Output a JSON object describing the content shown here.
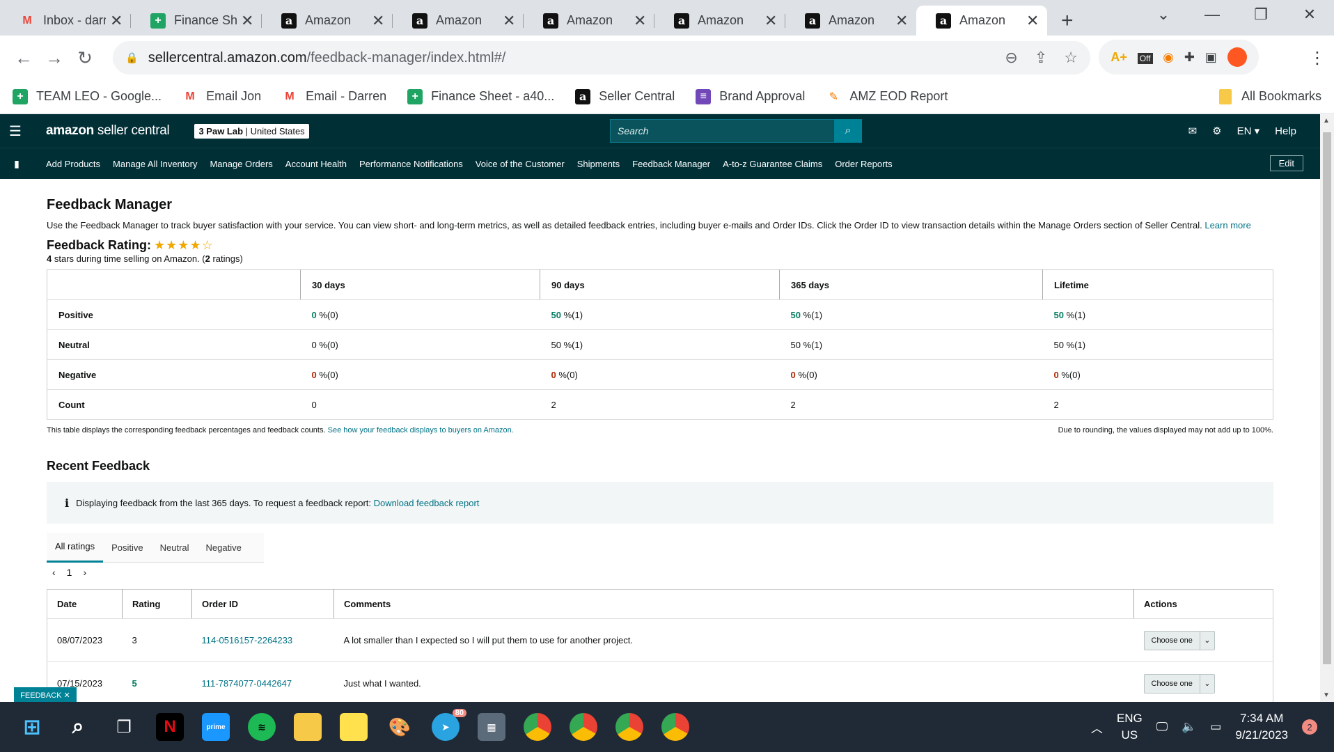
{
  "browser": {
    "tabs": [
      {
        "title": "Inbox - darr",
        "icon": "gmail"
      },
      {
        "title": "Finance She",
        "icon": "sheets"
      },
      {
        "title": "Amazon",
        "icon": "amazon"
      },
      {
        "title": "Amazon",
        "icon": "amazon"
      },
      {
        "title": "Amazon",
        "icon": "amazon"
      },
      {
        "title": "Amazon",
        "icon": "amazon"
      },
      {
        "title": "Amazon",
        "icon": "amazon"
      },
      {
        "title": "Amazon",
        "icon": "amazon"
      }
    ],
    "url_host": "sellercentral.amazon.com",
    "url_path": "/feedback-manager/index.html#/",
    "ext_off": "Off",
    "bookmarks": [
      {
        "label": "TEAM LEO - Google...",
        "icon": "sheets"
      },
      {
        "label": "Email Jon",
        "icon": "gmail"
      },
      {
        "label": "Email - Darren",
        "icon": "gmail"
      },
      {
        "label": "Finance Sheet - a40...",
        "icon": "sheets"
      },
      {
        "label": "Seller Central",
        "icon": "amazon"
      },
      {
        "label": "Brand Approval",
        "icon": "forms"
      },
      {
        "label": "AMZ EOD Report",
        "icon": "report"
      }
    ],
    "all_bookmarks": "All Bookmarks"
  },
  "header": {
    "brand_bold": "amazon",
    "brand_light": " seller central",
    "store_bold": "3 Paw Lab",
    "store_region": "United States",
    "search_placeholder": "Search",
    "lang": "EN",
    "help": "Help",
    "nav": [
      "Add Products",
      "Manage All Inventory",
      "Manage Orders",
      "Account Health",
      "Performance Notifications",
      "Voice of the Customer",
      "Shipments",
      "Feedback Manager",
      "A-to-z Guarantee Claims",
      "Order Reports"
    ],
    "edit": "Edit"
  },
  "page": {
    "title": "Feedback Manager",
    "description": "Use the Feedback Manager to track buyer satisfaction with your service. You can view short- and long-term metrics, as well as detailed feedback entries, including buyer e-mails and Order IDs. Click the Order ID to view transaction details within the Manage Orders section of Seller Central.",
    "learn_more": "Learn more",
    "rating_title": "Feedback Rating:",
    "rating_stars": 4,
    "rating_sub_stars": "4",
    "rating_sub_text1": " stars during time selling on Amazon. (",
    "rating_sub_count": "2",
    "rating_sub_text2": " ratings)",
    "metrics": {
      "columns": [
        "30 days",
        "90 days",
        "365 days",
        "Lifetime"
      ],
      "rows": [
        {
          "label": "Positive",
          "tone": "g",
          "cells": [
            [
              "0",
              " %(0)"
            ],
            [
              "50",
              " %(1)"
            ],
            [
              "50",
              " %(1)"
            ],
            [
              "50",
              " %(1)"
            ]
          ]
        },
        {
          "label": "Neutral",
          "tone": "",
          "cells": [
            [
              "0",
              " %(0)"
            ],
            [
              "50",
              " %(1)"
            ],
            [
              "50",
              " %(1)"
            ],
            [
              "50",
              " %(1)"
            ]
          ]
        },
        {
          "label": "Negative",
          "tone": "r",
          "cells": [
            [
              "0",
              " %(0)"
            ],
            [
              "0",
              " %(0)"
            ],
            [
              "0",
              " %(0)"
            ],
            [
              "0",
              " %(0)"
            ]
          ]
        },
        {
          "label": "Count",
          "tone": "",
          "cells": [
            [
              "0",
              ""
            ],
            [
              "2",
              ""
            ],
            [
              "2",
              ""
            ],
            [
              "2",
              ""
            ]
          ]
        }
      ]
    },
    "note_left": "This table displays the corresponding feedback percentages and feedback counts.",
    "note_link": "See how your feedback displays to buyers on Amazon.",
    "note_right": "Due to rounding, the values displayed may not add up to 100%.",
    "recent_title": "Recent Feedback",
    "info_text": "Displaying feedback from the last 365 days. To request a feedback report:",
    "info_link": "Download feedback report",
    "filter_tabs": [
      "All ratings",
      "Positive",
      "Neutral",
      "Negative"
    ],
    "page_num": "1",
    "feedback_columns": [
      "Date",
      "Rating",
      "Order ID",
      "Comments",
      "Actions"
    ],
    "feedback_rows": [
      {
        "date": "08/07/2023",
        "rating": "3",
        "order": "114-0516157-2264233",
        "comment": "A lot smaller than I expected so I will put them to use for another project.",
        "action": "Choose one"
      },
      {
        "date": "07/15/2023",
        "rating": "5",
        "order": "111-7874077-0442647",
        "comment": "Just what I wanted.",
        "action": "Choose one"
      }
    ],
    "feedback_tag": "FEEDBACK ✕"
  },
  "taskbar": {
    "lang1": "ENG",
    "lang2": "US",
    "time": "7:34 AM",
    "date": "9/21/2023",
    "notif": "2",
    "telegram_badge": "80"
  }
}
